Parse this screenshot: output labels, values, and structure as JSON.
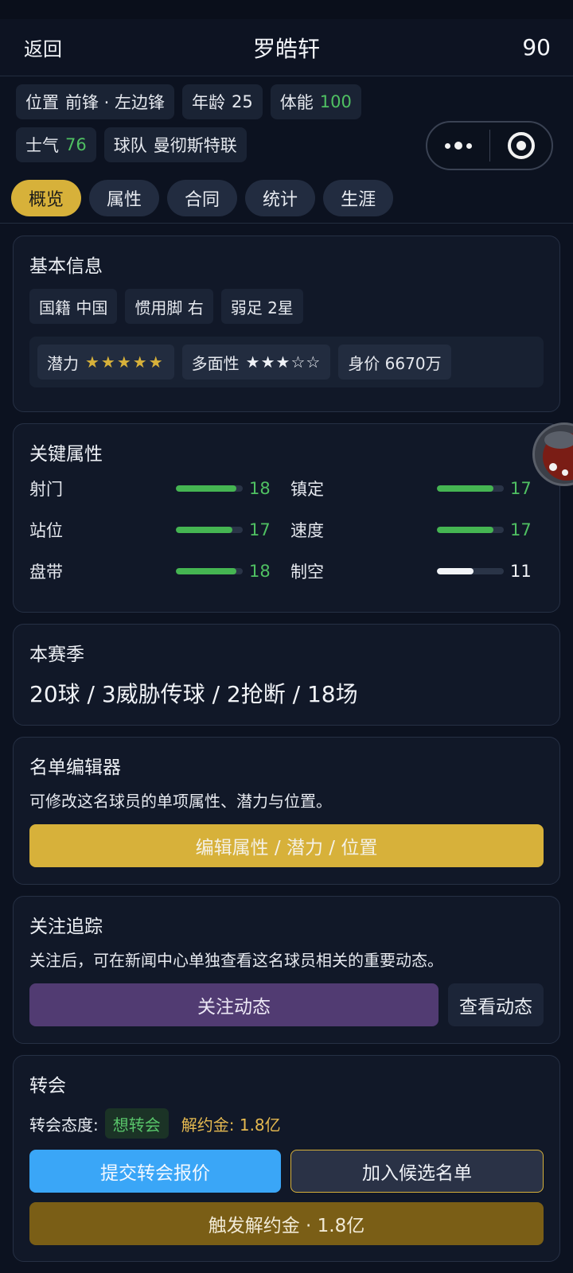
{
  "header": {
    "back": "返回",
    "title": "罗皓轩",
    "rating": "90"
  },
  "chips": [
    {
      "label": "位置",
      "value": "前锋 · 左边锋",
      "green": false
    },
    {
      "label": "年龄",
      "value": "25",
      "green": false
    },
    {
      "label": "体能",
      "value": "100",
      "green": true
    },
    {
      "label": "士气",
      "value": "76",
      "green": true
    },
    {
      "label": "球队",
      "value": "曼彻斯特联",
      "green": false
    }
  ],
  "tabs": [
    "概览",
    "属性",
    "合同",
    "统计",
    "生涯"
  ],
  "basic": {
    "title": "基本信息",
    "nationality": "国籍 中国",
    "foot": "惯用脚 右",
    "weak_foot": "弱足 2星",
    "potential_label": "潜力",
    "potential_stars": "★★★★★",
    "versatility_label": "多面性",
    "versatility_stars": "★★★☆☆",
    "value": "身价 6670万"
  },
  "key_attrs": {
    "title": "关键属性",
    "items": [
      {
        "name": "射门",
        "value": "18",
        "level": 0.9,
        "color": "green"
      },
      {
        "name": "镇定",
        "value": "17",
        "level": 0.85,
        "color": "green"
      },
      {
        "name": "站位",
        "value": "17",
        "level": 0.85,
        "color": "green"
      },
      {
        "name": "速度",
        "value": "17",
        "level": 0.85,
        "color": "green"
      },
      {
        "name": "盘带",
        "value": "18",
        "level": 0.9,
        "color": "green"
      },
      {
        "name": "制空",
        "value": "11",
        "level": 0.55,
        "color": "white"
      }
    ]
  },
  "season": {
    "title": "本赛季",
    "stats": "20球 / 3威胁传球 / 2抢断 / 18场"
  },
  "editor": {
    "title": "名单编辑器",
    "desc": "可修改这名球员的单项属性、潜力与位置。",
    "button": "编辑属性 / 潜力 / 位置"
  },
  "follow": {
    "title": "关注追踪",
    "desc": "关注后，可在新闻中心单独查看这名球员相关的重要动态。",
    "follow_button": "关注动态",
    "view_button": "查看动态"
  },
  "transfer": {
    "title": "转会",
    "attitude_label": "转会态度:",
    "attitude_value": "想转会",
    "release_clause": "解约金: 1.8亿",
    "offer_button": "提交转会报价",
    "shortlist_button": "加入候选名单",
    "trigger_button": "触发解约金 · 1.8亿"
  },
  "colors": {
    "gold": "#d7b13a",
    "green": "#4fc062",
    "blue": "#3aa6f7",
    "purple": "#513b72"
  }
}
